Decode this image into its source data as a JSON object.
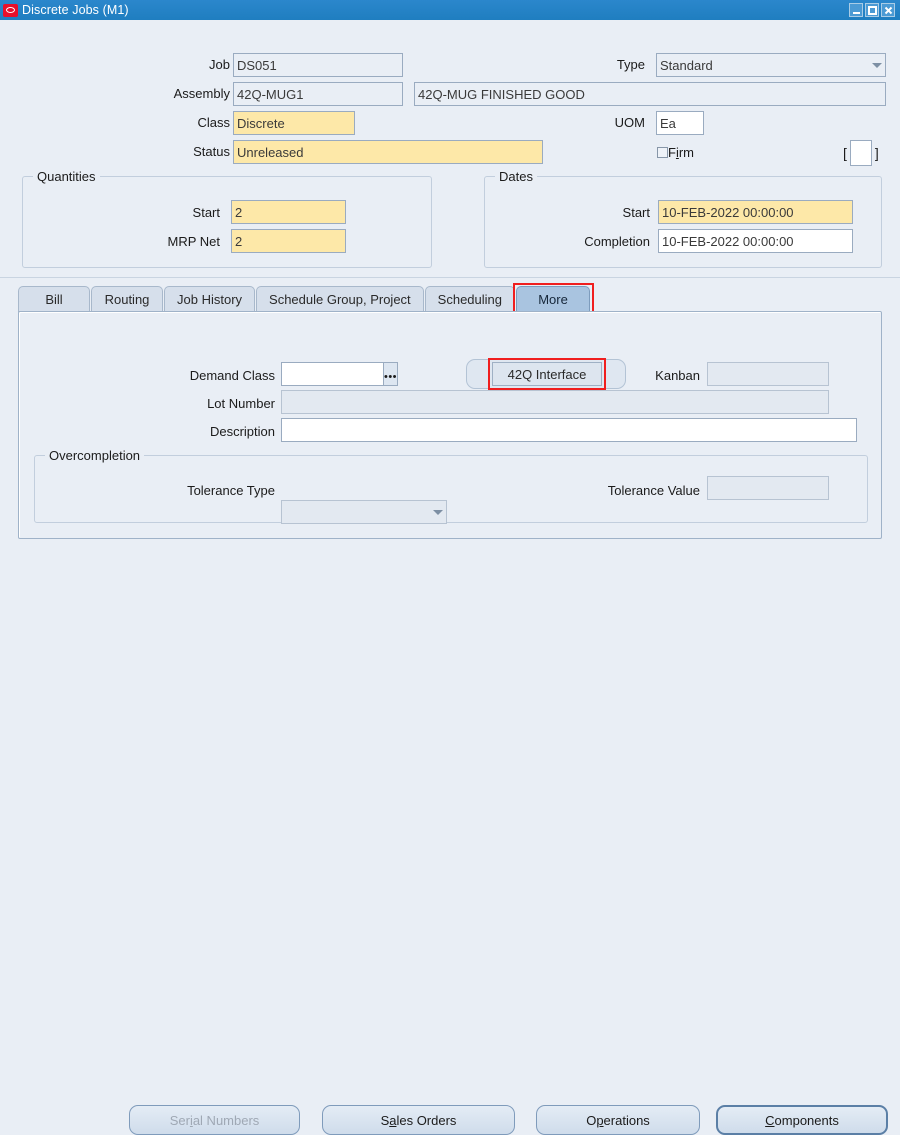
{
  "window": {
    "title": "Discrete Jobs (M1)",
    "logo_icon": "oracle-logo-icon",
    "buttons": [
      {
        "name": "minimize",
        "icon": "minimize-icon"
      },
      {
        "name": "maximize",
        "icon": "maximize-icon"
      },
      {
        "name": "close",
        "icon": "close-icon"
      }
    ]
  },
  "header": {
    "job": {
      "label": "Job",
      "value": "DS051"
    },
    "type": {
      "label": "Type",
      "value": "Standard",
      "icon": "chevron-down-icon"
    },
    "assembly": {
      "label": "Assembly",
      "value": "42Q-MUG1"
    },
    "assembly_description": {
      "value": "42Q-MUG FINISHED GOOD"
    },
    "class": {
      "label": "Class",
      "value": "Discrete"
    },
    "uom": {
      "label": "UOM",
      "value": "Ea"
    },
    "status": {
      "label": "Status",
      "value": "Unreleased"
    },
    "firm": {
      "label": "Firm",
      "checked": false,
      "icon": "checkbox-icon"
    },
    "bracket_left": "[",
    "bracket_right": "]",
    "bracket_field": {
      "value": ""
    }
  },
  "quantities": {
    "legend": "Quantities",
    "start": {
      "label": "Start",
      "value": "2"
    },
    "mrp_net": {
      "label": "MRP Net",
      "value": "2"
    }
  },
  "dates": {
    "legend": "Dates",
    "start": {
      "label": "Start",
      "value": "10-FEB-2022 00:00:00"
    },
    "completion": {
      "label": "Completion",
      "value": "10-FEB-2022 00:00:00"
    }
  },
  "tabs": [
    {
      "label": "Bill",
      "active": false
    },
    {
      "label": "Routing",
      "active": false
    },
    {
      "label": "Job History",
      "active": false
    },
    {
      "label": "Schedule Group, Project",
      "active": false
    },
    {
      "label": "Scheduling",
      "active": false
    },
    {
      "label": "More",
      "active": true
    }
  ],
  "more_tab": {
    "demand_class": {
      "label": "Demand Class",
      "value": "",
      "lov_icon": "list-of-values-icon",
      "lov_glyph": "•••"
    },
    "q42_interface": {
      "label": "42Q Interface"
    },
    "kanban": {
      "label": "Kanban",
      "value": ""
    },
    "lot_number": {
      "label": "Lot Number",
      "value": ""
    },
    "description": {
      "label": "Description",
      "value": ""
    },
    "overcompletion": {
      "legend": "Overcompletion",
      "tolerance_type": {
        "label": "Tolerance Type",
        "value": "",
        "icon": "chevron-down-icon"
      },
      "tolerance_value": {
        "label": "Tolerance Value",
        "value": ""
      }
    }
  },
  "footer_buttons": [
    {
      "label_pre": "Ser",
      "label_key": "i",
      "label_post": "al Numbers",
      "full": "Serial Numbers",
      "disabled": true,
      "default": false
    },
    {
      "label_pre": "S",
      "label_key": "a",
      "label_post": "les Orders",
      "full": "Sales Orders",
      "disabled": false,
      "default": false
    },
    {
      "label_pre": "O",
      "label_key": "p",
      "label_post": "erations",
      "full": "Operations",
      "disabled": false,
      "default": false
    },
    {
      "label_pre": "",
      "label_key": "C",
      "label_post": "omponents",
      "full": "Components",
      "disabled": false,
      "default": true
    }
  ],
  "colors": {
    "titlebar": "#2b87cc",
    "window_bg": "#e9eef5",
    "required_field": "#fde8a8",
    "active_tab": "#a9c4e0",
    "annotation": "#f01e1e",
    "oracle_red": "#e8102a"
  }
}
